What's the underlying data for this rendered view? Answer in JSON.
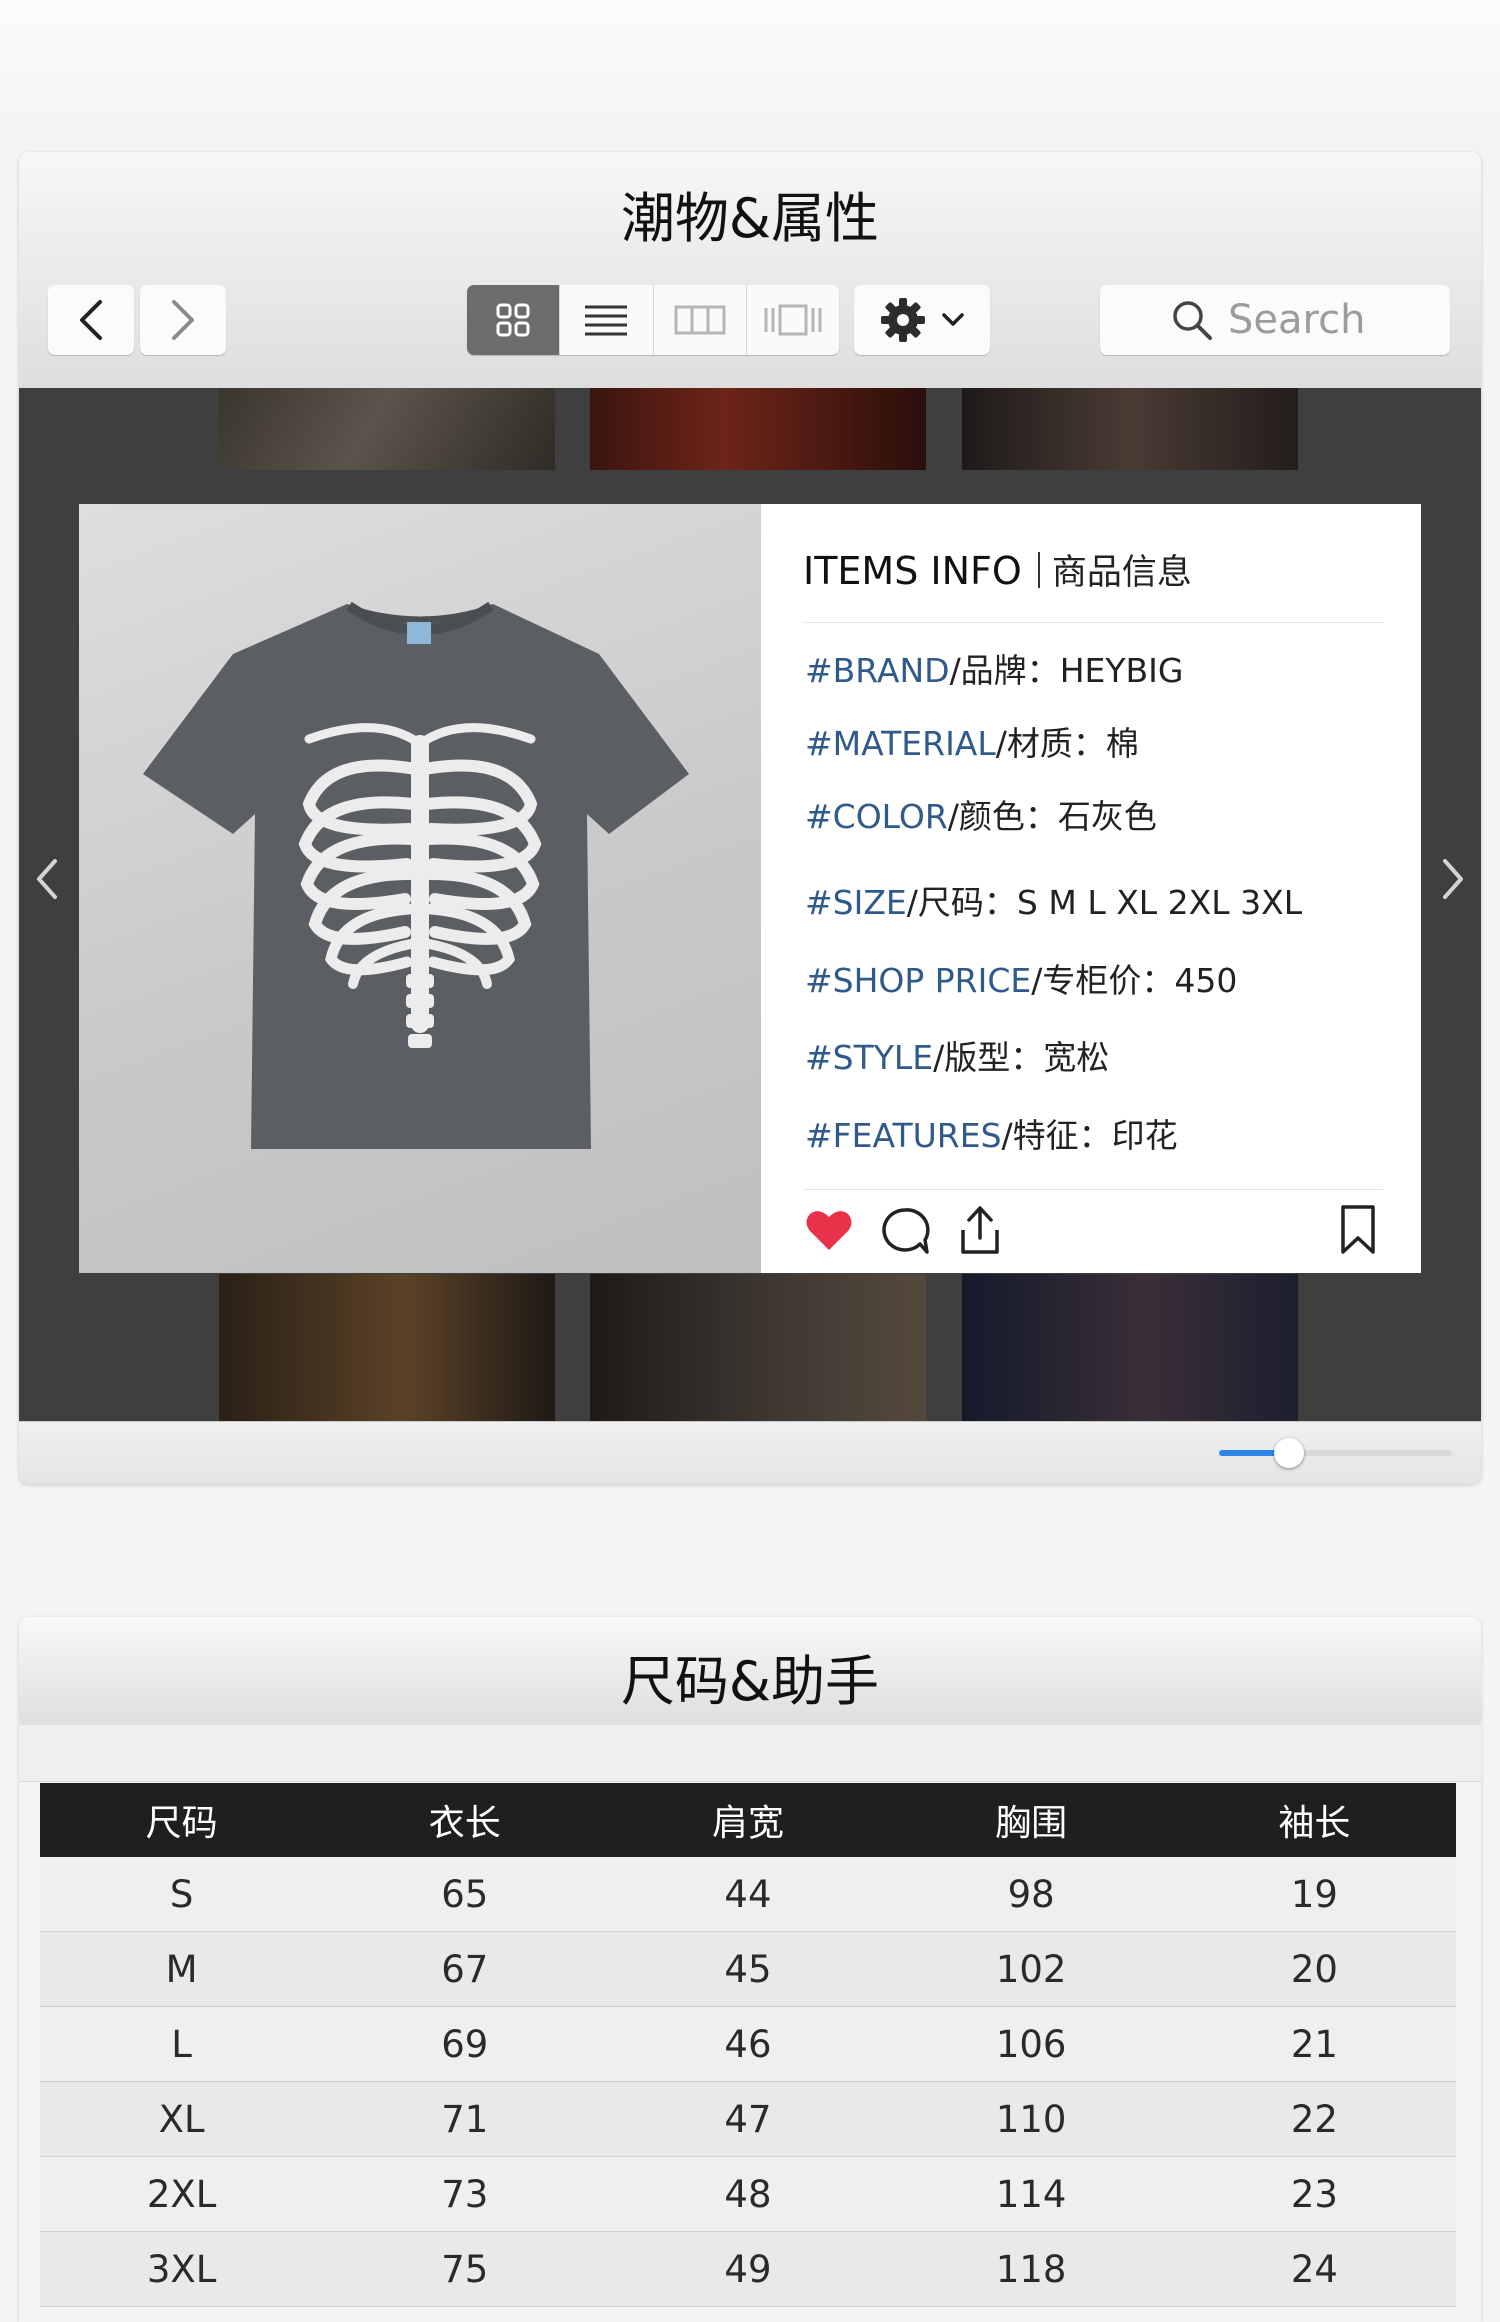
{
  "window1": {
    "title": "潮物&属性",
    "search_placeholder": "Search",
    "zoom_level": 0.3,
    "info": {
      "heading": "ITEMS INFO",
      "heading_zh": "商品信息",
      "rows": [
        {
          "tag": "#BRAND",
          "label": "/品牌：",
          "value": "HEYBIG"
        },
        {
          "tag": "#MATERIAL",
          "label": "/材质：",
          "value": "棉"
        },
        {
          "tag": "#COLOR",
          "label": "/颜色：",
          "value": "石灰色"
        },
        {
          "tag": "#SIZE",
          "label": "/尺码：",
          "value": "S M L XL 2XL 3XL"
        },
        {
          "tag": "#SHOP PRICE",
          "label": "/专柜价：",
          "value": "450"
        },
        {
          "tag": "#STYLE",
          "label": "/版型：",
          "value": "宽松"
        },
        {
          "tag": "#FEATURES",
          "label": "/特征：",
          "value": "印花"
        }
      ]
    },
    "colors": {
      "tag": "#2f5a8a",
      "heart": "#e8324a",
      "slider": "#2c87e8"
    },
    "icons": [
      "back-icon",
      "forward-icon",
      "grid-view-icon",
      "list-view-icon",
      "column-view-icon",
      "coverflow-view-icon",
      "gear-icon",
      "chevron-down-icon",
      "search-icon",
      "heart-icon",
      "comment-icon",
      "share-icon",
      "bookmark-icon",
      "prev-arrow-icon",
      "next-arrow-icon"
    ]
  },
  "window2": {
    "title": "尺码&助手",
    "table": {
      "headers": [
        "尺码",
        "衣长",
        "肩宽",
        "胸围",
        "袖长"
      ],
      "rows": [
        [
          "S",
          "65",
          "44",
          "98",
          "19"
        ],
        [
          "M",
          "67",
          "45",
          "102",
          "20"
        ],
        [
          "L",
          "69",
          "46",
          "106",
          "21"
        ],
        [
          "XL",
          "71",
          "47",
          "110",
          "22"
        ],
        [
          "2XL",
          "73",
          "48",
          "114",
          "23"
        ],
        [
          "3XL",
          "75",
          "49",
          "118",
          "24"
        ]
      ]
    }
  }
}
